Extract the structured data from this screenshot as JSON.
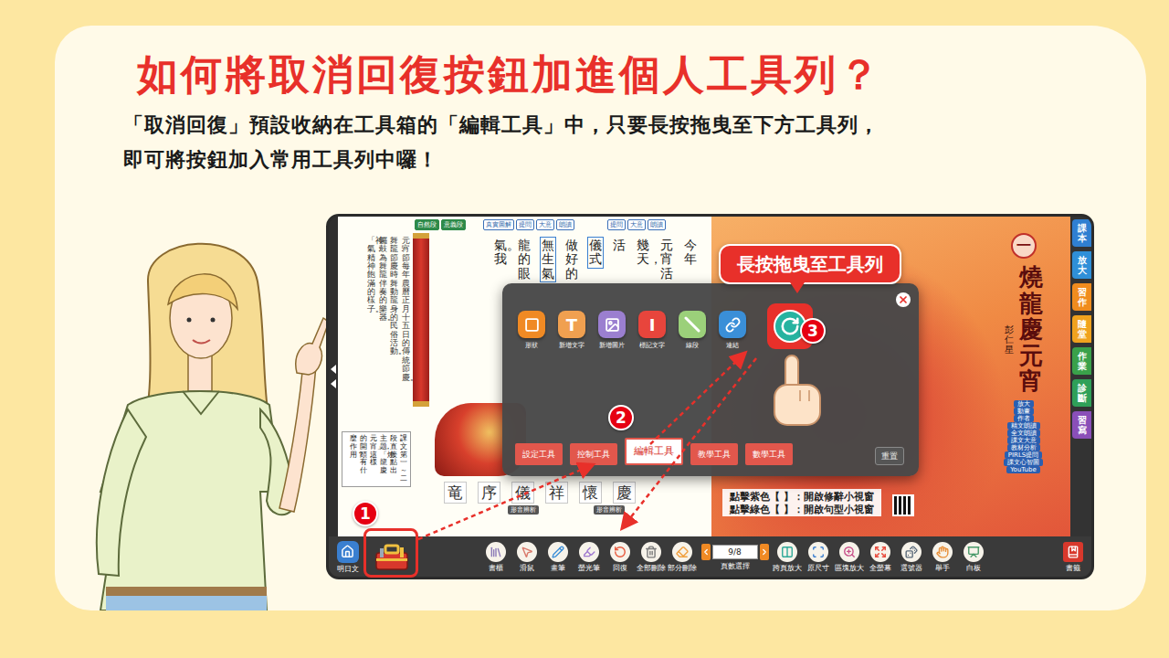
{
  "slide": {
    "title": "如何將取消回復按鈕加進個人工具列？",
    "description": [
      "「取消回復」預設收納在工具箱的「編輯工具」中，只要長按拖曳至下方工具列，",
      "即可將按鈕加入常用工具列中囉！"
    ]
  },
  "callout": "長按拖曳至工具列",
  "steps": [
    {
      "number": "1"
    },
    {
      "number": "2"
    },
    {
      "number": "3"
    }
  ],
  "left_page": {
    "section_tags": [
      "自然段",
      "意義段"
    ],
    "tag_groups": [
      [
        "真實圖解",
        "提問",
        "大意",
        "朗讀"
      ],
      [
        "提問",
        "大意",
        "朗讀"
      ]
    ],
    "notes": [
      "元宵節：每年農曆正月十五日的傳統節慶。",
      "舞龍：節慶時舞動龍身的民俗活動。",
      "鑼鼓：為舞龍伴奏的樂器。",
      "「神」氣：精神飽滿的樣子。"
    ],
    "question": [
      "課文第一～二",
      "段，直接點出",
      "主題「燒龍慶",
      "元宵」，這樣",
      "的開頭，有什",
      "麼作用？"
    ],
    "text_columns": [
      {
        "text": "今年",
        "marked": false
      },
      {
        "text": "元宵活",
        "marked": false
      },
      {
        "text": "幾天，",
        "marked": false
      },
      {
        "text": "活",
        "marked": false
      },
      {
        "text": "儀式",
        "marked": true
      },
      {
        "text": "做好的",
        "marked": false
      },
      {
        "text": "無生氣",
        "marked": true
      },
      {
        "text": "龍的眼",
        "marked": false
      },
      {
        "text": "氣。我",
        "marked": false
      }
    ],
    "word_strip": [
      "竜",
      "序",
      "儀",
      "祥",
      "懷",
      "慶"
    ],
    "strip_tags": [
      "形音辨析",
      "形音辨析"
    ]
  },
  "right_page": {
    "lesson": "一",
    "title": "燒龍慶元宵",
    "author": "彭仁星",
    "buttons": [
      "放大",
      "動畫",
      "作者",
      "精文朗讀",
      "全文朗讀",
      "課文大意",
      "教材分析",
      "PIRLS提問",
      "課文心智圖",
      "YouTube"
    ],
    "captions": [
      "點擊紫色【 】：開啟修辭小視窗",
      "點擊綠色【 】：開啟句型小視窗"
    ]
  },
  "side_tabs": [
    {
      "label": "課本",
      "color": "#2f7fd1"
    },
    {
      "label": "放大",
      "color": "#2f8fd8"
    },
    {
      "label": "習作",
      "color": "#f08c1e"
    },
    {
      "label": "隨堂",
      "color": "#f0a21e"
    },
    {
      "label": "作業",
      "color": "#3aa14a"
    },
    {
      "label": "診斷",
      "color": "#2fa058"
    },
    {
      "label": "習寫",
      "color": "#8a4fb8"
    }
  ],
  "popup": {
    "tools": [
      {
        "label": "形狀",
        "kind": "icon",
        "color": "#f08a24"
      },
      {
        "label": "新增文字",
        "kind": "glyph",
        "glyph": "T",
        "color": "#f0a050"
      },
      {
        "label": "新增圖片",
        "kind": "icon",
        "color": "#9b7fd0"
      },
      {
        "label": "標記文字",
        "kind": "glyph",
        "glyph": "I",
        "color": "#e8453c"
      },
      {
        "label": "線段",
        "kind": "line",
        "color": "#9bd07a"
      },
      {
        "label": "連結",
        "kind": "icon",
        "color": "#3a8fd8"
      }
    ],
    "drag_item": {
      "highlighted": true,
      "color": "#26b3a0"
    },
    "tabs": [
      {
        "label": "設定工具",
        "selected": false
      },
      {
        "label": "控制工具",
        "selected": false
      },
      {
        "label": "編輯工具",
        "selected": true
      },
      {
        "label": "教學工具",
        "selected": false
      },
      {
        "label": "數學工具",
        "selected": false
      }
    ],
    "reset": "重置"
  },
  "toolbar": {
    "home": "明日文",
    "toolbox": {
      "highlighted": true
    },
    "tools_left": [
      {
        "label": "書櫃",
        "color": "#8c7bb8"
      },
      {
        "label": "滑鼠",
        "color": "#d9786a"
      },
      {
        "label": "畫筆",
        "color": "#3c8fd8"
      },
      {
        "label": "螢光筆",
        "color": "#a07ad0"
      },
      {
        "label": "回復",
        "color": "#e8583c"
      },
      {
        "label": "全部刪除",
        "color": "#7a7a7a"
      },
      {
        "label": "部分刪除",
        "color": "#f0a040"
      }
    ],
    "pager": {
      "value": "9/8",
      "label": "頁數選擇"
    },
    "tools_right": [
      {
        "label": "跨頁放大",
        "color": "#2fa898"
      },
      {
        "label": "原尺寸",
        "color": "#3c7fd0"
      },
      {
        "label": "區塊放大",
        "color": "#c8508a"
      },
      {
        "label": "全螢幕",
        "color": "#e84a3c"
      },
      {
        "label": "選號器",
        "color": "#5a6a7a"
      },
      {
        "label": "舉手",
        "color": "#e8903a"
      },
      {
        "label": "白板",
        "color": "#4a9a6a"
      }
    ],
    "bookmark": "書籤"
  }
}
